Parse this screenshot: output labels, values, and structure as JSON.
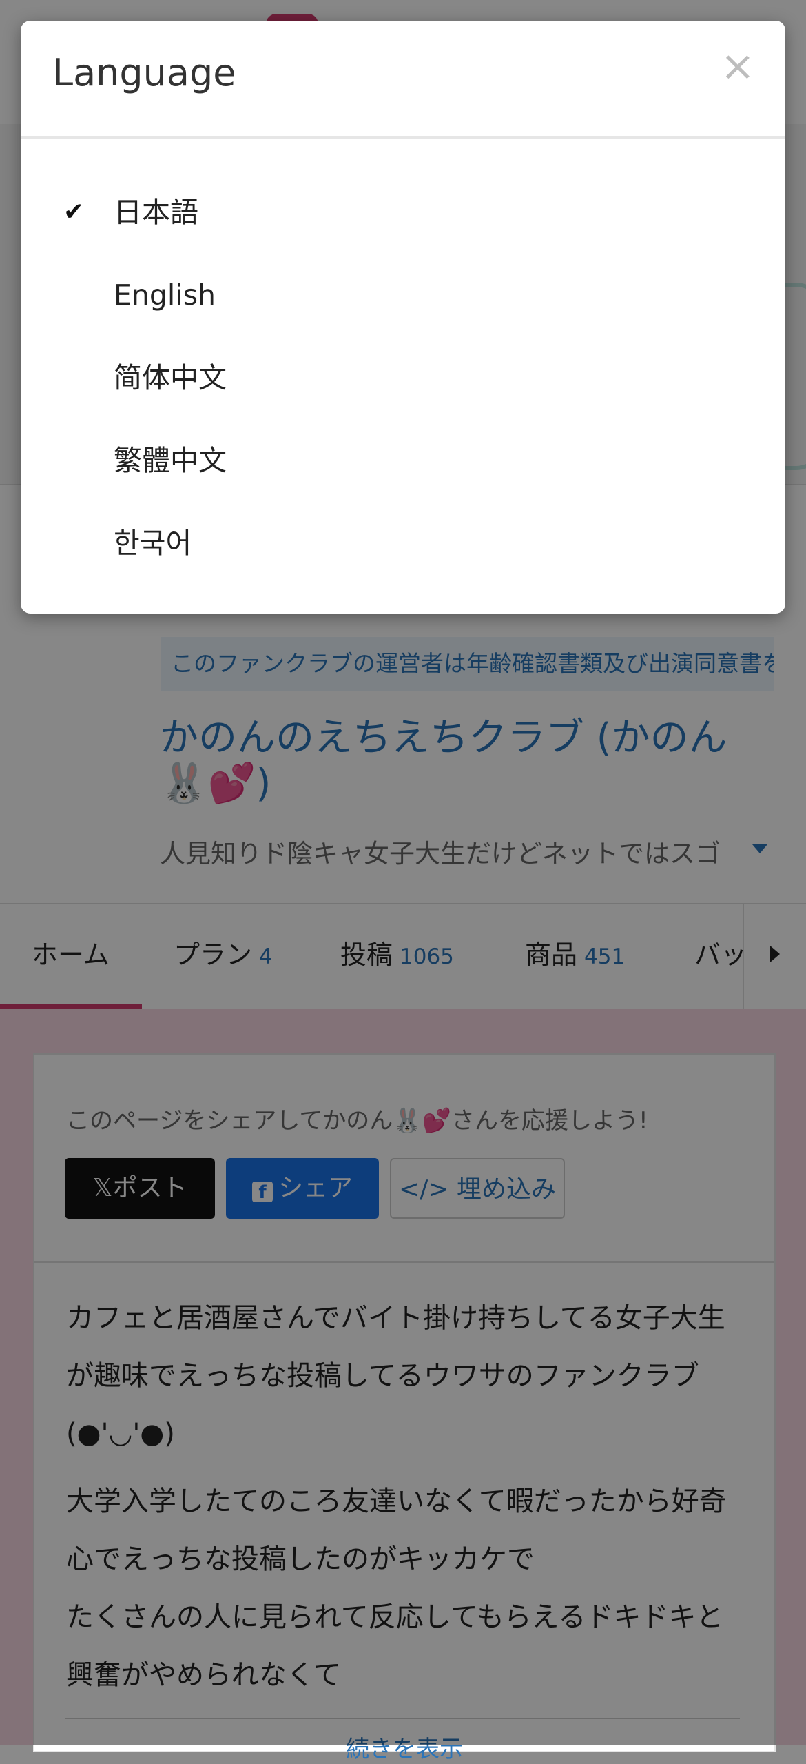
{
  "modal": {
    "title": "Language",
    "close_glyph": "×",
    "check_glyph": "✔",
    "languages": [
      {
        "label": "日本語",
        "selected": true
      },
      {
        "label": "English",
        "selected": false
      },
      {
        "label": "简体中文",
        "selected": false
      },
      {
        "label": "繁體中文",
        "selected": false
      },
      {
        "label": "한국어",
        "selected": false
      }
    ]
  },
  "page": {
    "notice": "このファンクラブの運営者は年齢確認書類及び出演同意書を",
    "club_title": "かのんのえちえちクラブ (かのん🐰💕)",
    "tagline": "人見知りド陰キャ女子大生だけどネットではスゴ",
    "tabs": [
      {
        "label": "ホーム",
        "count": ""
      },
      {
        "label": "プラン",
        "count": "4"
      },
      {
        "label": "投稿",
        "count": "1065"
      },
      {
        "label": "商品",
        "count": "451"
      },
      {
        "label": "バッ",
        "count": ""
      }
    ],
    "share_prompt": "このページをシェアしてかのん🐰💕さんを応援しよう!",
    "post_button": "𝕏ポスト",
    "share_button": "シェア",
    "fb_glyph": "f",
    "embed_button": "</> 埋め込み",
    "description": [
      "カフェと居酒屋さんでバイト掛け持ちしてる女子大生が趣味でえっちな投稿してるウワサのファンクラブ(●'◡'●)",
      "大学入学したてのころ友達いなくて暇だったから好奇心でえっちな投稿したのがキッカケで",
      "たくさんの人に見られて反応してもらえるドキドキと興奮がやめられなくて"
    ],
    "read_more": "続きを表示"
  },
  "colors": {
    "accent_pink": "#d23c6e",
    "link_blue": "#2b74b8",
    "facebook_blue": "#1a73e8"
  }
}
